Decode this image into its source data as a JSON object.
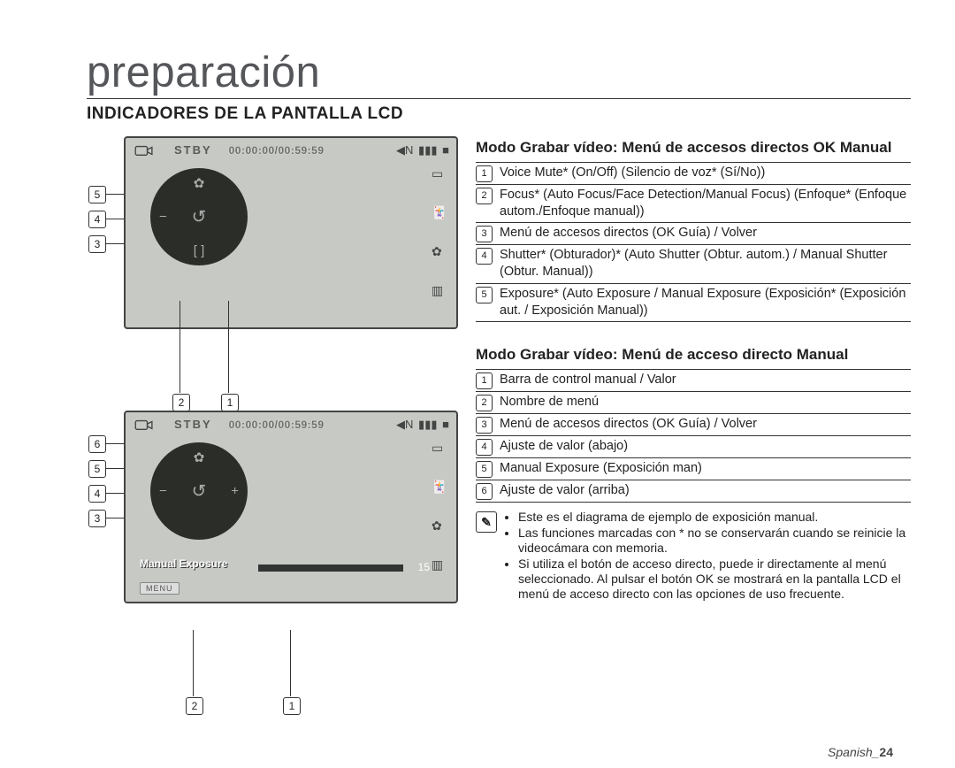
{
  "page_title": "preparación",
  "section_title": "INDICADORES DE LA PANTALLA LCD",
  "screen_common": {
    "status": "STBY",
    "time": "00:00:00/00:59:59",
    "icon_sound": "◀N",
    "icon_battery": "▮▮▮",
    "icon_card": "■"
  },
  "screen1": {
    "wheel_up": "✿",
    "wheel_down": "[ ]",
    "wheel_left": "−",
    "wheel_right": "",
    "wheel_center": "↺",
    "right_icons": [
      "▭",
      "🃏",
      "✿",
      "▥"
    ],
    "callout_side": [
      "5",
      "4",
      "3"
    ],
    "callout_bottom": [
      "2",
      "1"
    ]
  },
  "screen2": {
    "wheel_up": "✿",
    "wheel_down": " ",
    "wheel_left": "−",
    "wheel_right": "+",
    "wheel_center": "↺",
    "right_icons": [
      "▭",
      "🃏",
      "✿",
      "▥"
    ],
    "manual_label": "Manual Exposure",
    "value_num": "15",
    "menu_label": "MENU",
    "callout_side": [
      "6",
      "5",
      "4",
      "3"
    ],
    "callout_bottom": [
      "2",
      "1"
    ]
  },
  "subhead1": "Modo Grabar vídeo: Menú de accesos directos OK Manual",
  "list1_top_border": true,
  "list1": [
    "Voice Mute* (On/Off) (Silencio de voz* (Sí/No))",
    "Focus* (Auto Focus/Face Detection/Manual Focus) (Enfoque* (Enfoque autom./Enfoque manual))",
    "Menú de accesos directos (OK Guía) / Volver",
    "Shutter* (Obturador)* (Auto Shutter (Obtur. autom.) / Manual Shutter (Obtur. Manual))",
    "Exposure* (Auto Exposure / Manual Exposure (Exposición* (Exposición aut. / Exposición Manual))"
  ],
  "subhead2": "Modo Grabar vídeo: Menú de acceso directo Manual",
  "list2": [
    "Barra de control manual / Valor",
    "Nombre de menú",
    "Menú de accesos directos (OK Guía) / Volver",
    "Ajuste de valor (abajo)",
    "Manual Exposure (Exposición man)",
    "Ajuste de valor (arriba)"
  ],
  "notes": [
    "Este es el diagrama de ejemplo de exposición manual.",
    "Las funciones marcadas con * no se conservarán cuando se reinicie la videocámara con memoria.",
    "Si utiliza el botón de acceso directo, puede ir directamente al menú seleccionado. Al pulsar el botón OK se mostrará en la pantalla LCD el menú de acceso directo con las opciones de uso frecuente."
  ],
  "page_number_label": "Spanish_",
  "page_number": "24"
}
